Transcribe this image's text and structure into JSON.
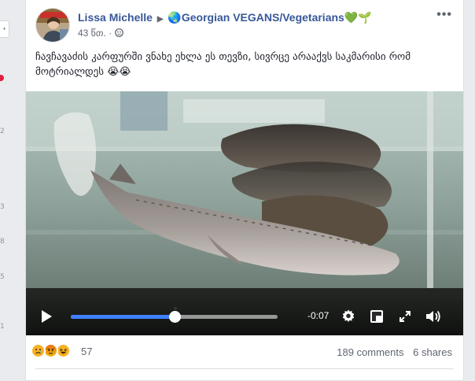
{
  "left_rail": {
    "chip": "•",
    "numbers": [
      "2",
      "3",
      "8",
      "5",
      "1"
    ]
  },
  "post": {
    "author": "Lissa Michelle",
    "group": "🌏Georgian VEGANS/Vegetarians💚🌱",
    "timestamp": "43 წთ.",
    "privacy_icon": "group-privacy-icon",
    "more_icon": "more-options-icon",
    "text": "ჩავჩავაძის კარფურში ვნახე ეხლა ეს თევზი, სივრცე არააქვს საკმარისი რომ მოტრიალდეს 😭😭"
  },
  "video": {
    "time_remaining": "-0:07",
    "progress": 0.5,
    "accent_color": "#4080ff",
    "icons": [
      "play-icon",
      "settings-icon",
      "mini-player-icon",
      "fullscreen-icon",
      "volume-icon"
    ]
  },
  "footer": {
    "reaction_count": "57",
    "reactions": [
      "sad",
      "angry",
      "haha"
    ],
    "comments": "189 comments",
    "shares": "6 shares"
  }
}
